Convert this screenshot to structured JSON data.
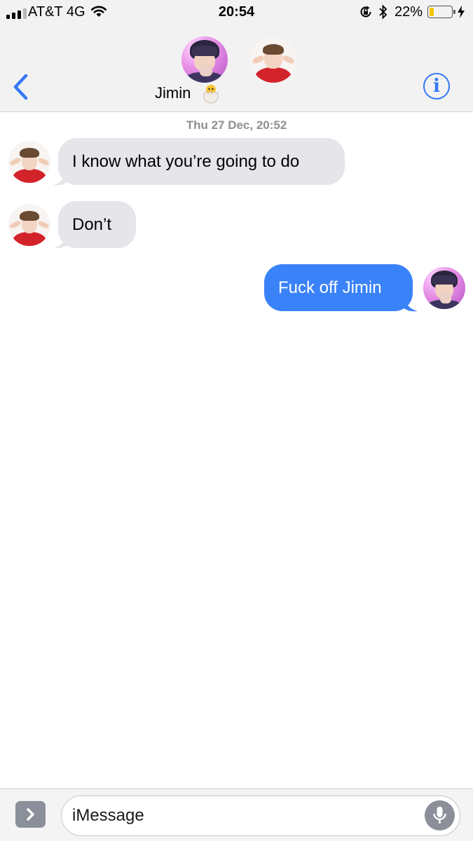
{
  "status_bar": {
    "carrier": "AT&T 4G",
    "time": "20:54",
    "battery_percent": "22%",
    "battery_level": 0.22,
    "battery_color": "#f5c400"
  },
  "header": {
    "contact_name": "Jimin",
    "back_icon": "chevron-left-icon",
    "info_icon": "info-icon",
    "info_glyph": "i",
    "accent": "#3478f6"
  },
  "conversation": {
    "timestamp": "Thu 27 Dec, 20:52",
    "messages": [
      {
        "direction": "incoming",
        "text": "I know what you’re going to do"
      },
      {
        "direction": "incoming",
        "text": "Don’t"
      },
      {
        "direction": "outgoing",
        "text": "Fuck off Jimin"
      }
    ],
    "incoming_color": "#e5e5ea",
    "outgoing_color": "#3a82f7"
  },
  "input_bar": {
    "placeholder": "iMessage",
    "apps_icon": "chevron-right-icon",
    "mic_icon": "microphone-icon"
  }
}
